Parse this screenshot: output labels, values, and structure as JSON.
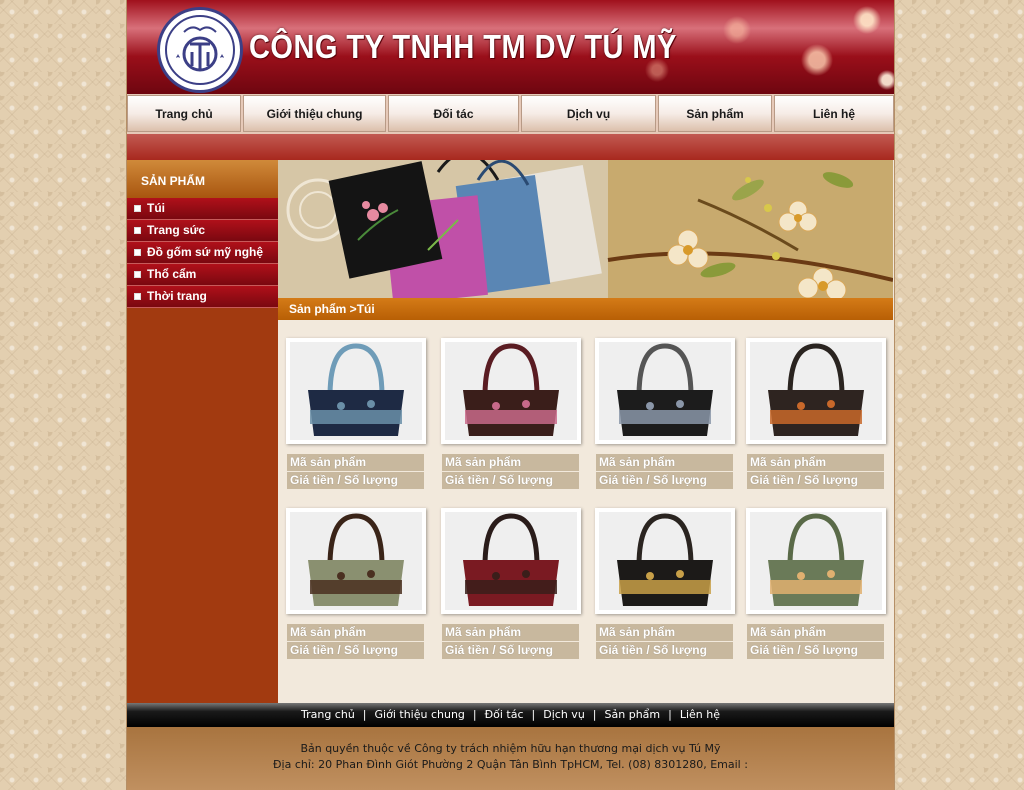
{
  "header": {
    "company_name": "CÔNG TY TNHH TM DV TÚ MỸ",
    "logo_letters": "TM"
  },
  "nav": {
    "items": [
      "Trang chủ",
      "Giới thiệu chung",
      "Đối tác",
      "Dịch vụ",
      "Sản phẩm",
      "Liên hệ"
    ]
  },
  "sidebar": {
    "title": "SẢN PHẨM",
    "items": [
      "Túi",
      "Trang sức",
      "Đồ gốm sứ mỹ nghệ",
      "Thổ cẩm",
      "Thời trang"
    ]
  },
  "breadcrumb": "Sản phẩm >Túi",
  "products": [
    {
      "code_label": "Mã sản phẩm",
      "price_label": "Giá tiền / Số lượng",
      "bag_color": "#1e2a44",
      "accent": "#6a8fa8",
      "handle": "#6f9cb8"
    },
    {
      "code_label": "Mã sản phẩm",
      "price_label": "Giá tiền / Số lượng",
      "bag_color": "#3a1e1a",
      "accent": "#c86a8a",
      "handle": "#5a1c22"
    },
    {
      "code_label": "Mã sản phẩm",
      "price_label": "Giá tiền / Số lượng",
      "bag_color": "#1c1c1c",
      "accent": "#8a96a8",
      "handle": "#555"
    },
    {
      "code_label": "Mã sản phẩm",
      "price_label": "Giá tiền / Số lượng",
      "bag_color": "#2e2420",
      "accent": "#c8682a",
      "handle": "#2a2420"
    },
    {
      "code_label": "Mã sản phẩm",
      "price_label": "Giá tiền / Số lượng",
      "bag_color": "#8a9070",
      "accent": "#4a3020",
      "handle": "#3a2418"
    },
    {
      "code_label": "Mã sản phẩm",
      "price_label": "Giá tiền / Số lượng",
      "bag_color": "#7a1a22",
      "accent": "#3a1e1a",
      "handle": "#2a1c1a"
    },
    {
      "code_label": "Mã sản phẩm",
      "price_label": "Giá tiền / Số lượng",
      "bag_color": "#1c1a18",
      "accent": "#c8a048",
      "handle": "#2a2420"
    },
    {
      "code_label": "Mã sản phẩm",
      "price_label": "Giá tiền / Số lượng",
      "bag_color": "#6a7a58",
      "accent": "#e0b070",
      "handle": "#5a6a48"
    }
  ],
  "footer_nav": {
    "items": [
      "Trang chủ",
      "Giới thiệu chung",
      "Đối tác",
      "Dịch vụ",
      "Sản phẩm",
      "Liên hệ"
    ],
    "separator": "|"
  },
  "footer": {
    "copyright": "Bản quyền thuộc về Công ty trách nhiệm hữu hạn thương mại dịch vụ Tú Mỹ",
    "address": "Địa chỉ: 20 Phan Đình Giót Phường 2 Quận Tân Bình TpHCM, Tel. (08) 8301280, Email :"
  },
  "colors": {
    "header_red": "#a0101c",
    "sidebar_bg": "#a23a10",
    "breadcrumb_orange": "#c46a0b",
    "label_bar": "#c8b89e",
    "page_bg": "#f2e9dc"
  }
}
